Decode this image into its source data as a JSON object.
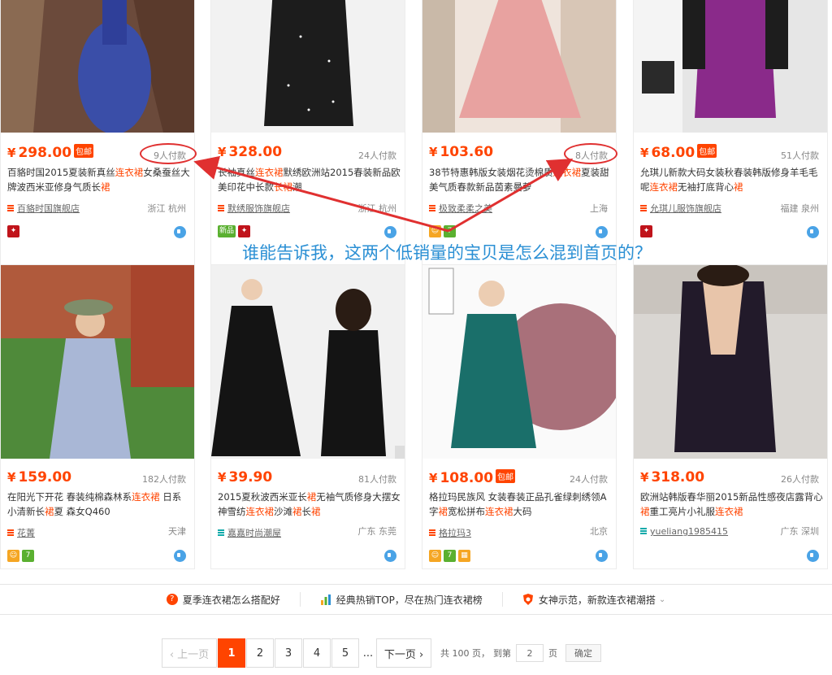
{
  "products": [
    {
      "price": "298.00",
      "baoyou": "包邮",
      "sales": "9人付款",
      "title_parts": [
        "百貉时国2015夏装新真丝",
        "连衣裙",
        "女桑蚕丝大牌波西米亚修身气质长",
        "裙"
      ],
      "shop": "百貉时国旗舰店",
      "location": "浙江 杭州"
    },
    {
      "price": "328.00",
      "baoyou": "",
      "sales": "24人付款",
      "title_parts": [
        "长袖真丝",
        "连衣裙",
        "默绣欧洲站2015春装新品欧美印花中长款",
        "长裙",
        "潮"
      ],
      "shop": "默绣服饰旗舰店",
      "location": "浙江 杭州"
    },
    {
      "price": "103.60",
      "baoyou": "",
      "sales": "8人付款",
      "title_parts": [
        "38节特惠韩版女装烟花烫棉质",
        "连衣裙",
        "夏装甜美气质春款新品茵素曼萝"
      ],
      "shop": "极致柔柔之美",
      "location": "上海"
    },
    {
      "price": "68.00",
      "baoyou": "包邮",
      "sales": "51人付款",
      "title_parts": [
        "允琪儿新款大码女装秋春装韩版修身羊毛毛呢",
        "连衣裙",
        "无袖打底背心",
        "裙"
      ],
      "shop": "允琪儿服饰旗舰店",
      "location": "福建 泉州"
    },
    {
      "price": "159.00",
      "baoyou": "",
      "sales": "182人付款",
      "title_parts": [
        "在阳光下开花 春装纯棉森林系",
        "连衣裙",
        " 日系小清新长",
        "裙",
        "夏 森女Q460"
      ],
      "shop": "花菁",
      "location": "天津"
    },
    {
      "price": "39.90",
      "baoyou": "",
      "sales": "81人付款",
      "title_parts": [
        "2015夏秋波西米亚长",
        "裙",
        "无袖气质修身大摆女神雪纺",
        "连衣裙",
        "沙滩",
        "裙",
        "长",
        "裙"
      ],
      "shop": "嘉嘉时尚潮屋",
      "location": "广东 东莞"
    },
    {
      "price": "108.00",
      "baoyou": "包邮",
      "sales": "24人付款",
      "title_parts": [
        "格拉玛民族风 女装春装正品孔雀绿刺绣领A字",
        "裙",
        "宽松拼布",
        "连衣裙",
        "大码"
      ],
      "shop": "格拉玛3",
      "location": "北京"
    },
    {
      "price": "318.00",
      "baoyou": "",
      "sales": "26人付款",
      "title_parts": [
        "欧洲站韩版春华丽2015新品性感夜店露背心",
        "裙",
        "重工亮片小礼服",
        "连衣裙"
      ],
      "shop": "yueliang1985415",
      "location": "广东 深圳"
    }
  ],
  "badges": {
    "xinpin": "新品"
  },
  "currency": "¥",
  "annotation": "谁能告诉我，这两个低销量的宝贝是怎么混到首页的？",
  "tips": [
    "夏季连衣裙怎么搭配好",
    "经典热销TOP，尽在热门连衣裙榜",
    "女神示范，新款连衣裙潮搭"
  ],
  "pager": {
    "prev": "‹ 上一页",
    "pages": [
      "1",
      "2",
      "3",
      "4",
      "5"
    ],
    "dots": "...",
    "next": "下一页 ›",
    "total": "共 100 页，",
    "goto": "到第",
    "goto_value": "2",
    "page_unit": "页",
    "confirm": "确定"
  },
  "colors": {
    "accent": "#ff4400",
    "annotation_text": "#2a8fd4",
    "annotation_mark": "#e03030"
  }
}
